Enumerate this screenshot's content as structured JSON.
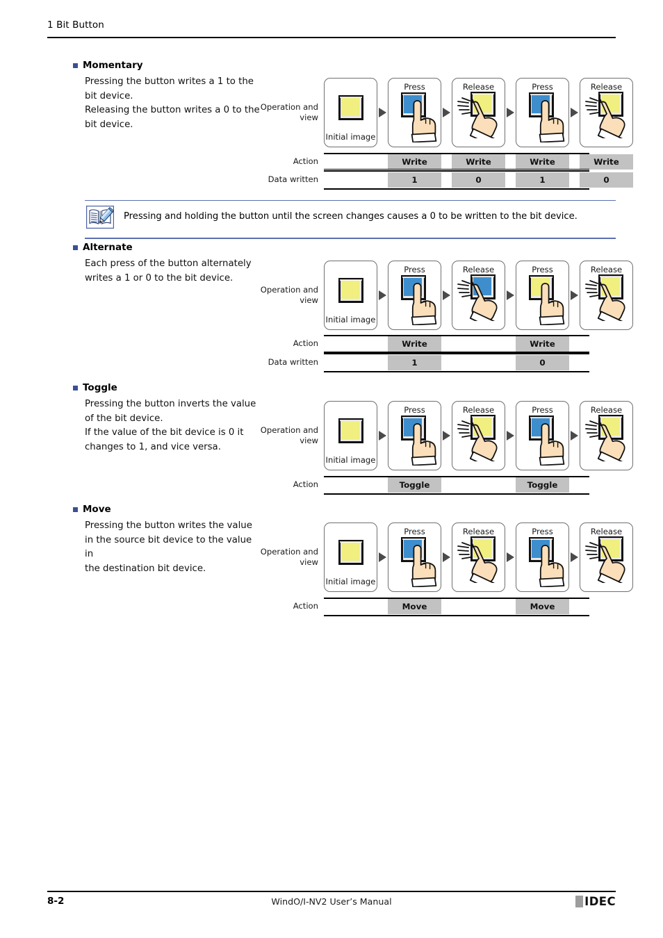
{
  "header": {
    "title": "1 Bit Button"
  },
  "footer": {
    "page_number": "8-2",
    "manual_title": "WindO/I-NV2 User’s Manual",
    "logo_text": "IDEC"
  },
  "note": {
    "icon": "notepad-pencil-icon",
    "text": "Pressing and holding the button until the screen changes causes a 0 to be written to the bit device."
  },
  "labels": {
    "operation_and_view": "Operation and\nview",
    "operation_and_view_line1": "Operation and",
    "operation_and_view_line2": "view",
    "action": "Action",
    "data_written": "Data written",
    "initial_image": "Initial image",
    "press": "Press",
    "release": "Release"
  },
  "colors": {
    "bullet": "#3c4f93",
    "button_yellow": "#f0ef80",
    "button_blue": "#3e8ecd",
    "cell_fill": "#c2c2c2",
    "note_rule": "#5b6fb0",
    "logo_square": "#9d9d9d"
  },
  "sections": [
    {
      "id": "momentary",
      "heading": "Momentary",
      "body": [
        "Pressing the button writes a 1 to the",
        "bit device.",
        "Releasing the button writes a 0 to the",
        "bit device."
      ],
      "steps": [
        {
          "caption": "",
          "sub": "Initial image",
          "state": "yellow",
          "hand": "none"
        },
        {
          "caption": "Press",
          "sub": "",
          "state": "blue",
          "hand": "press"
        },
        {
          "caption": "Release",
          "sub": "",
          "state": "yellow",
          "hand": "release"
        },
        {
          "caption": "Press",
          "sub": "",
          "state": "blue",
          "hand": "press"
        },
        {
          "caption": "Release",
          "sub": "",
          "state": "yellow",
          "hand": "release"
        }
      ],
      "rows": [
        {
          "label": "Action",
          "cells": [
            "",
            "Write",
            "Write",
            "Write",
            "Write"
          ]
        },
        {
          "label": "Data written",
          "cells": [
            "",
            "1",
            "0",
            "1",
            "0"
          ]
        }
      ]
    },
    {
      "id": "alternate",
      "heading": "Alternate",
      "body": [
        "Each press of the button alternately",
        "writes a 1 or 0 to the bit device."
      ],
      "steps": [
        {
          "caption": "",
          "sub": "Initial image",
          "state": "yellow",
          "hand": "none"
        },
        {
          "caption": "Press",
          "sub": "",
          "state": "blue",
          "hand": "press"
        },
        {
          "caption": "Release",
          "sub": "",
          "state": "blue",
          "hand": "release"
        },
        {
          "caption": "Press",
          "sub": "",
          "state": "yellow",
          "hand": "press"
        },
        {
          "caption": "Release",
          "sub": "",
          "state": "yellow",
          "hand": "release"
        }
      ],
      "rows": [
        {
          "label": "Action",
          "cells": [
            "",
            "Write",
            "",
            "Write",
            ""
          ]
        },
        {
          "label": "Data written",
          "cells": [
            "",
            "1",
            "",
            "0",
            ""
          ]
        }
      ]
    },
    {
      "id": "toggle",
      "heading": "Toggle",
      "body": [
        "Pressing the button inverts the value",
        "of the bit device.",
        "If the value of the bit device is 0 it",
        "changes to 1, and vice versa."
      ],
      "steps": [
        {
          "caption": "",
          "sub": "Initial image",
          "state": "yellow",
          "hand": "none"
        },
        {
          "caption": "Press",
          "sub": "",
          "state": "blue",
          "hand": "press"
        },
        {
          "caption": "Release",
          "sub": "",
          "state": "yellow",
          "hand": "release"
        },
        {
          "caption": "Press",
          "sub": "",
          "state": "blue",
          "hand": "press"
        },
        {
          "caption": "Release",
          "sub": "",
          "state": "yellow",
          "hand": "release"
        }
      ],
      "rows": [
        {
          "label": "Action",
          "cells": [
            "",
            "Toggle",
            "",
            "Toggle",
            ""
          ]
        }
      ]
    },
    {
      "id": "move",
      "heading": "Move",
      "body": [
        "Pressing the button writes the value",
        "in the source bit device to the value in",
        "the destination bit device."
      ],
      "steps": [
        {
          "caption": "",
          "sub": "Initial image",
          "state": "yellow",
          "hand": "none"
        },
        {
          "caption": "Press",
          "sub": "",
          "state": "blue",
          "hand": "press"
        },
        {
          "caption": "Release",
          "sub": "",
          "state": "yellow",
          "hand": "release"
        },
        {
          "caption": "Press",
          "sub": "",
          "state": "blue",
          "hand": "press"
        },
        {
          "caption": "Release",
          "sub": "",
          "state": "yellow",
          "hand": "release"
        }
      ],
      "rows": [
        {
          "label": "Action",
          "cells": [
            "",
            "Move",
            "",
            "Move",
            ""
          ]
        }
      ]
    }
  ]
}
